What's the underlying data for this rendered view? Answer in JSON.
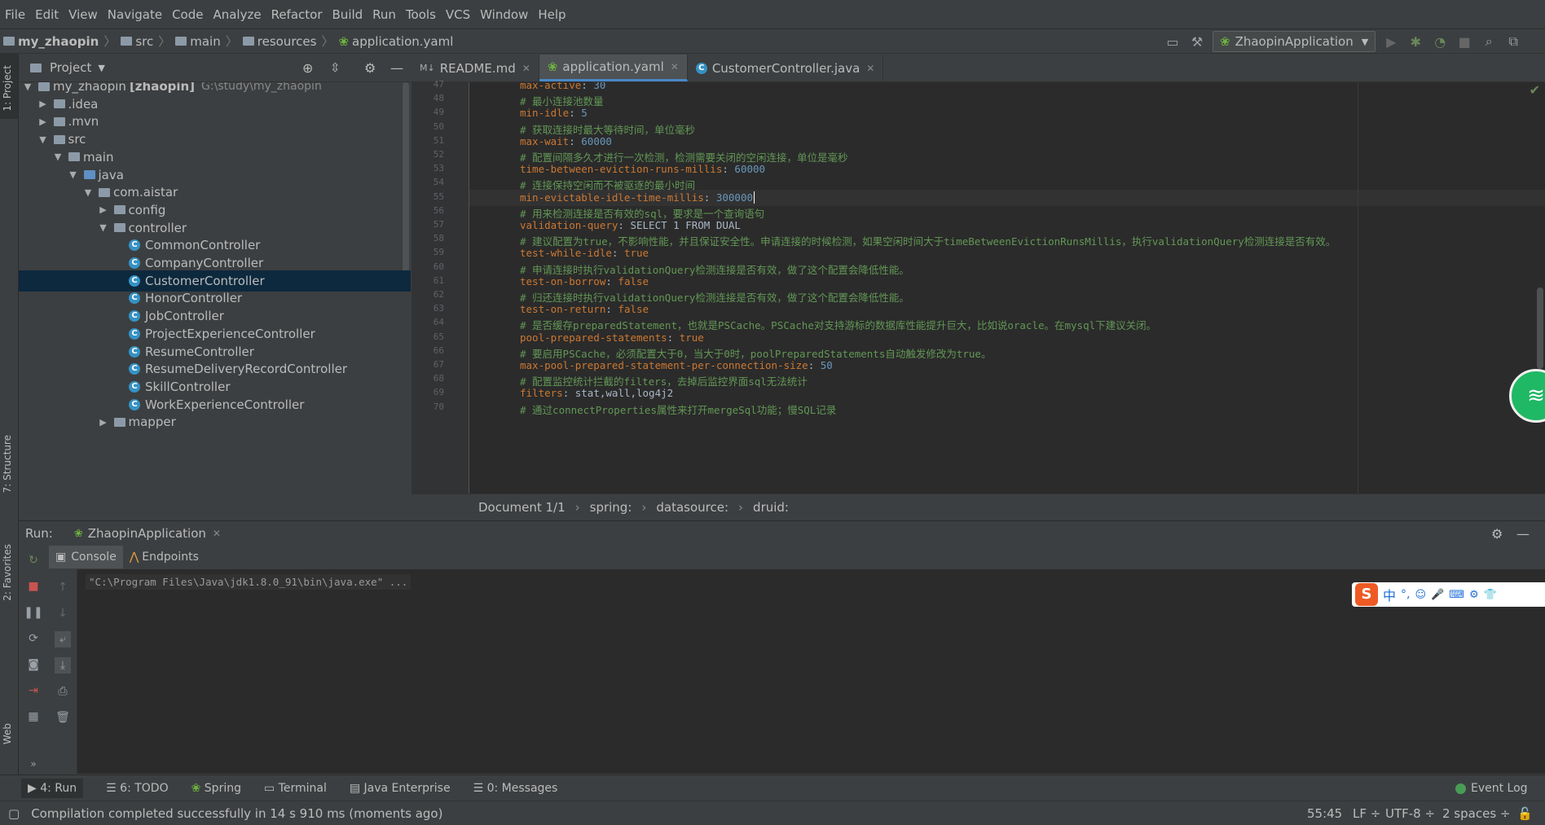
{
  "menu": [
    "File",
    "Edit",
    "View",
    "Navigate",
    "Code",
    "Analyze",
    "Refactor",
    "Build",
    "Run",
    "Tools",
    "VCS",
    "Window",
    "Help"
  ],
  "breadcrumb": [
    "my_zhaopin",
    "src",
    "main",
    "resources",
    "application.yaml"
  ],
  "run_config": "ZhaopinApplication",
  "left_strip": {
    "project": "1: Project",
    "structure": "7: Structure",
    "favorites": "2: Favorites",
    "web": "Web"
  },
  "project_panel": {
    "title": "Project"
  },
  "tree": [
    {
      "label": "my_zhaopin",
      "bold": "[zhaopin]",
      "path": "G:\\study\\my_zhaopin",
      "depth": 0,
      "arrow": "▼",
      "type": "folder"
    },
    {
      "label": ".idea",
      "depth": 1,
      "arrow": "▶",
      "type": "folder"
    },
    {
      "label": ".mvn",
      "depth": 1,
      "arrow": "▶",
      "type": "folder"
    },
    {
      "label": "src",
      "depth": 1,
      "arrow": "▼",
      "type": "folder"
    },
    {
      "label": "main",
      "depth": 2,
      "arrow": "▼",
      "type": "folder"
    },
    {
      "label": "java",
      "depth": 3,
      "arrow": "▼",
      "type": "folder-blue"
    },
    {
      "label": "com.aistar",
      "depth": 4,
      "arrow": "▼",
      "type": "package"
    },
    {
      "label": "config",
      "depth": 5,
      "arrow": "▶",
      "type": "package"
    },
    {
      "label": "controller",
      "depth": 5,
      "arrow": "▼",
      "type": "package"
    },
    {
      "label": "CommonController",
      "depth": 6,
      "type": "class"
    },
    {
      "label": "CompanyController",
      "depth": 6,
      "type": "class"
    },
    {
      "label": "CustomerController",
      "depth": 6,
      "type": "class",
      "selected": true
    },
    {
      "label": "HonorController",
      "depth": 6,
      "type": "class"
    },
    {
      "label": "JobController",
      "depth": 6,
      "type": "class"
    },
    {
      "label": "ProjectExperienceController",
      "depth": 6,
      "type": "class"
    },
    {
      "label": "ResumeController",
      "depth": 6,
      "type": "class"
    },
    {
      "label": "ResumeDeliveryRecordController",
      "depth": 6,
      "type": "class"
    },
    {
      "label": "SkillController",
      "depth": 6,
      "type": "class"
    },
    {
      "label": "WorkExperienceController",
      "depth": 6,
      "type": "class"
    },
    {
      "label": "mapper",
      "depth": 5,
      "arrow": "▶",
      "type": "package"
    }
  ],
  "tabs": [
    {
      "label": "README.md",
      "active": false
    },
    {
      "label": "application.yaml",
      "active": true
    },
    {
      "label": "CustomerController.java",
      "active": false
    }
  ],
  "code_lines": [
    {
      "n": "47",
      "k": "max-active",
      "v": "30",
      "vt": "num"
    },
    {
      "n": "48",
      "c": "# 最小连接池数量"
    },
    {
      "n": "49",
      "k": "min-idle",
      "v": "5",
      "vt": "num"
    },
    {
      "n": "50",
      "c": "# 获取连接时最大等待时间，单位毫秒"
    },
    {
      "n": "51",
      "k": "max-wait",
      "v": "60000",
      "vt": "num"
    },
    {
      "n": "52",
      "c": "# 配置间隔多久才进行一次检测，检测需要关闭的空闲连接，单位是毫秒"
    },
    {
      "n": "53",
      "k": "time-between-eviction-runs-millis",
      "v": "60000",
      "vt": "num"
    },
    {
      "n": "54",
      "c": "# 连接保持空闲而不被驱逐的最小时间"
    },
    {
      "n": "55",
      "k": "min-evictable-idle-time-millis",
      "v": "300000",
      "vt": "num",
      "current": true
    },
    {
      "n": "56",
      "c": "# 用来检测连接是否有效的sql，要求是一个查询语句"
    },
    {
      "n": "57",
      "k": "validation-query",
      "v": "SELECT 1 FROM DUAL",
      "vt": "str"
    },
    {
      "n": "58",
      "c": "# 建议配置为true，不影响性能，并且保证安全性。申请连接的时候检测，如果空闲时间大于timeBetweenEvictionRunsMillis，执行validationQuery检测连接是否有效。"
    },
    {
      "n": "59",
      "k": "test-while-idle",
      "v": "true",
      "vt": "key"
    },
    {
      "n": "60",
      "c": "# 申请连接时执行validationQuery检测连接是否有效，做了这个配置会降低性能。"
    },
    {
      "n": "61",
      "k": "test-on-borrow",
      "v": "false",
      "vt": "key"
    },
    {
      "n": "62",
      "c": "# 归还连接时执行validationQuery检测连接是否有效，做了这个配置会降低性能。"
    },
    {
      "n": "63",
      "k": "test-on-return",
      "v": "false",
      "vt": "key"
    },
    {
      "n": "64",
      "c": "# 是否缓存preparedStatement，也就是PSCache。PSCache对支持游标的数据库性能提升巨大，比如说oracle。在mysql下建议关闭。"
    },
    {
      "n": "65",
      "k": "pool-prepared-statements",
      "v": "true",
      "vt": "key"
    },
    {
      "n": "66",
      "c": "# 要启用PSCache，必须配置大于0，当大于0时，poolPreparedStatements自动触发修改为true。"
    },
    {
      "n": "67",
      "k": "max-pool-prepared-statement-per-connection-size",
      "v": "50",
      "vt": "num"
    },
    {
      "n": "68",
      "c": "# 配置监控统计拦截的filters，去掉后监控界面sql无法统计"
    },
    {
      "n": "69",
      "k": "filters",
      "v": "stat,wall,log4j2",
      "vt": "str"
    },
    {
      "n": "70",
      "c": "# 通过connectProperties属性来打开mergeSql功能；慢SQL记录"
    }
  ],
  "editor_breadcrumb": [
    "Document 1/1",
    "spring:",
    "datasource:",
    "druid:"
  ],
  "run_panel": {
    "label": "Run:",
    "config": "ZhaopinApplication",
    "subtabs": [
      "Console",
      "Endpoints"
    ],
    "console_text": "\"C:\\Program Files\\Java\\jdk1.8.0_91\\bin\\java.exe\" ..."
  },
  "bottom_tabs": [
    "4: Run",
    "6: TODO",
    "Spring",
    "Terminal",
    "Java Enterprise",
    "0: Messages"
  ],
  "event_log": "Event Log",
  "status": {
    "message": "Compilation completed successfully in 14 s 910 ms (moments ago)",
    "position": "55:45",
    "line_sep": "LF",
    "encoding": "UTF-8",
    "indent": "2 spaces"
  },
  "ime": {
    "lang": "中",
    "punct": "°,"
  }
}
